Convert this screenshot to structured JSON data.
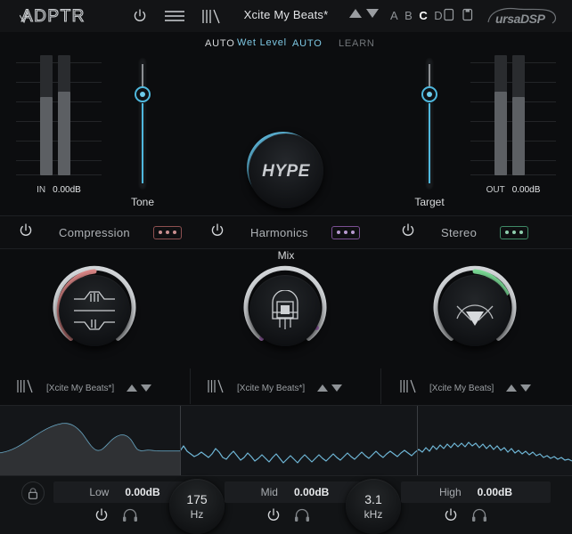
{
  "topbar": {
    "brand": "ADPTR",
    "power_icon": "power-icon",
    "menu_icon": "hamburger-menu-icon",
    "meter_icon": "meter-bars-icon",
    "preset_name": "Xcite My Beats*",
    "preset_up_icon": "triangle-up-icon",
    "preset_down_icon": "triangle-down-icon",
    "slots": [
      "A",
      "B",
      "C",
      "D"
    ],
    "selected_slot": "C",
    "copy_icon": "copy-icon",
    "paste_icon": "paste-icon",
    "vendor": "ursaDSP"
  },
  "autorow": {
    "auto_in": "AUTO",
    "wet_level": "Wet Level",
    "auto_out": "AUTO",
    "learn": "LEARN",
    "accent": "#7ec8e3"
  },
  "top_section": {
    "input_meter": {
      "label": "IN",
      "value": "0.00dB"
    },
    "output_meter": {
      "label": "OUT",
      "value": "0.00dB"
    },
    "tone": {
      "label": "Tone"
    },
    "target": {
      "label": "Target"
    },
    "mix": {
      "label": "Mix",
      "badge": "HYPE"
    }
  },
  "modules": [
    {
      "name": "Compression",
      "power_icon": "power-icon",
      "dots_icon": "options-dots-icon",
      "color": "#e08a8a",
      "glyph": "compressor-curve-icon",
      "preset": "[Xcite My Beats*]"
    },
    {
      "name": "Harmonics",
      "power_icon": "power-icon",
      "dots_icon": "options-dots-icon",
      "color": "#c27fd8",
      "glyph": "vacuum-tube-icon",
      "preset": "[Xcite My Beats*]"
    },
    {
      "name": "Stereo",
      "power_icon": "power-icon",
      "dots_icon": "options-dots-icon",
      "color": "#7ee09a",
      "glyph": "stereo-width-icon",
      "preset": "[Xcite My Beats]"
    }
  ],
  "preset_row": {
    "meter_icon": "meter-bars-icon",
    "up_icon": "triangle-up-icon",
    "down_icon": "triangle-down-icon"
  },
  "spectrum": {
    "curve_color": "#6fb6d6",
    "divider_color": "#3b3e42"
  },
  "bottom": {
    "lock_icon": "lock-icon",
    "bands": [
      {
        "name": "Low",
        "gain": "0.00dB",
        "power_icon": "power-icon",
        "solo_icon": "headphones-icon"
      },
      {
        "name": "Mid",
        "gain": "0.00dB",
        "power_icon": "power-icon",
        "solo_icon": "headphones-icon"
      },
      {
        "name": "High",
        "gain": "0.00dB",
        "power_icon": "power-icon",
        "solo_icon": "headphones-icon"
      }
    ],
    "crossovers": [
      {
        "value": "175",
        "unit": "Hz"
      },
      {
        "value": "3.1",
        "unit": "kHz"
      }
    ]
  }
}
